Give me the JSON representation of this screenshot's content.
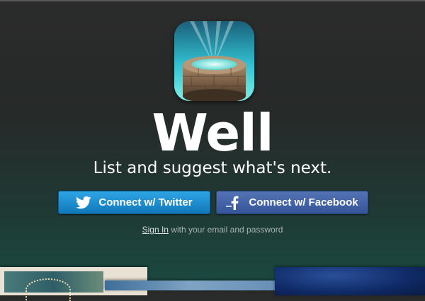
{
  "app": {
    "name": "Well",
    "tagline": "List and suggest what's next.",
    "icon": "well-app-icon"
  },
  "auth": {
    "twitter_label": "Connect w/ Twitter",
    "facebook_label": "Connect w/ Facebook",
    "twitter_icon": "twitter-bird-icon",
    "facebook_icon": "facebook-f-icon",
    "signin_link": "Sign In",
    "signin_suffix": "with your email and password"
  },
  "colors": {
    "twitter": "#1a8ed0",
    "facebook": "#3f5fa3",
    "background": "#262a29"
  }
}
